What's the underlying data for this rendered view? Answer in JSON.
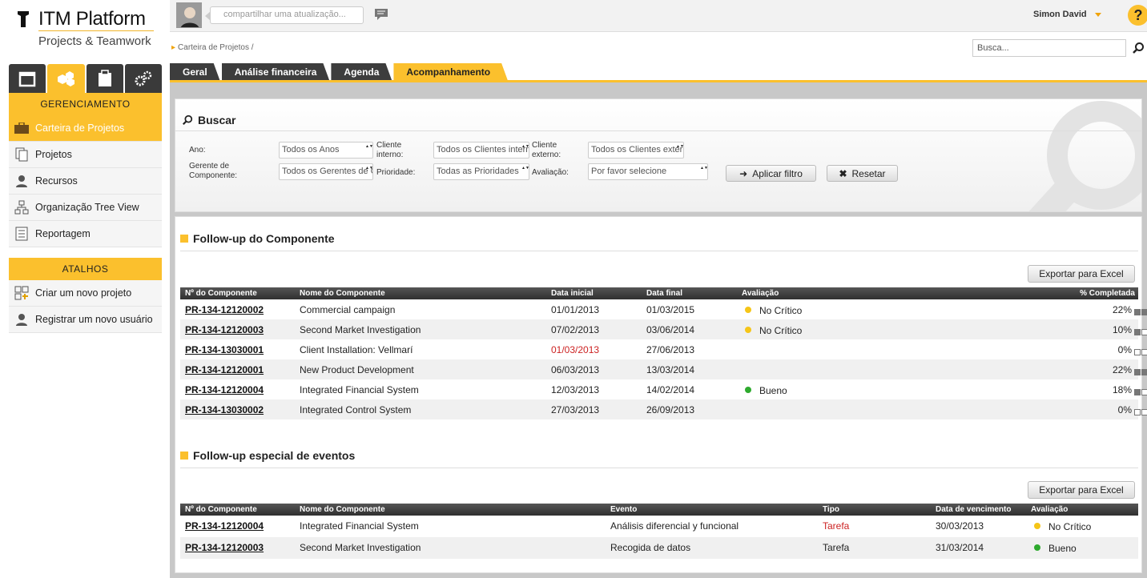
{
  "app": {
    "title": "ITM Platform",
    "subtitle": "Projects & Teamwork"
  },
  "sidebar": {
    "tabs": [
      "calendar-icon",
      "projects-cubes-icon",
      "clipboard-icon",
      "gears-icon"
    ],
    "section1": "GERENCIAMENTO",
    "items": [
      {
        "label": "Carteira de Projetos",
        "icon": "briefcase-icon",
        "active": true
      },
      {
        "label": "Projetos",
        "icon": "documents-icon"
      },
      {
        "label": "Recursos",
        "icon": "person-icon"
      },
      {
        "label": "Organização Tree View",
        "icon": "tree-icon"
      },
      {
        "label": "Reportagem",
        "icon": "report-icon"
      }
    ],
    "section2": "ATALHOS",
    "shortcuts": [
      {
        "label": "Criar um novo projeto",
        "icon": "new-project-icon"
      },
      {
        "label": "Registrar um novo usuário",
        "icon": "person-icon"
      }
    ]
  },
  "topbar": {
    "share_placeholder": "compartilhar uma atualização...",
    "user": "Simon David",
    "help": "?"
  },
  "breadcrumb": "Carteira de Projetos /",
  "search": {
    "placeholder": "Busca..."
  },
  "tabs": [
    "Geral",
    "Análise financeira",
    "Agenda",
    "Acompanhamento"
  ],
  "filter": {
    "title": "Buscar",
    "ano_label": "Ano:",
    "ano_value": "Todos os Anos",
    "cliente_interno_label": "Cliente interno:",
    "cliente_interno_value": "Todos os Clientes internos",
    "cliente_externo_label": "Cliente externo:",
    "cliente_externo_value": "Todos os Clientes externos",
    "gerente_label": "Gerente de Componente:",
    "gerente_value": "Todos os Gerentes de Componente",
    "prioridade_label": "Prioridade:",
    "prioridade_value": "Todas as Prioridades",
    "avaliacao_label": "Avaliação:",
    "avaliacao_value": "Por favor selecione",
    "apply": "Aplicar filtro",
    "reset": "Resetar"
  },
  "followup": {
    "title": "Follow-up do Componente",
    "export": "Exportar para Excel",
    "headers": [
      "Nº do Componente",
      "Nome do Componente",
      "Data inicial",
      "Data final",
      "Avaliação",
      "% Completada"
    ],
    "rows": [
      {
        "code": "PR-134-12120002",
        "name": "Commercial campaign",
        "start": "01/01/2013",
        "end": "01/03/2015",
        "eval": "No Crítico",
        "color": "#f5c518",
        "pct": "22%",
        "filled": 2
      },
      {
        "code": "PR-134-12120003",
        "name": "Second Market Investigation",
        "start": "07/02/2013",
        "end": "03/06/2014",
        "eval": "No Crítico",
        "color": "#f5c518",
        "pct": "10%",
        "filled": 1
      },
      {
        "code": "PR-134-13030001",
        "name": "Client Installation: Vellmarí",
        "start": "01/03/2013",
        "end": "27/06/2013",
        "eval": "",
        "color": "",
        "pct": "0%",
        "filled": 0,
        "start_red": true
      },
      {
        "code": "PR-134-12120001",
        "name": "New Product Development",
        "start": "06/03/2013",
        "end": "13/03/2014",
        "eval": "",
        "color": "",
        "pct": "22%",
        "filled": 2
      },
      {
        "code": "PR-134-12120004",
        "name": "Integrated Financial System",
        "start": "12/03/2013",
        "end": "14/02/2014",
        "eval": "Bueno",
        "color": "#2eaa2e",
        "pct": "18%",
        "filled": 1
      },
      {
        "code": "PR-134-13030002",
        "name": "Integrated Control System",
        "start": "27/03/2013",
        "end": "26/09/2013",
        "eval": "",
        "color": "",
        "pct": "0%",
        "filled": 0
      }
    ]
  },
  "events": {
    "title": "Follow-up especial de eventos",
    "export": "Exportar para Excel",
    "headers": [
      "Nº do Componente",
      "Nome do Componente",
      "Evento",
      "Tipo",
      "Data de vencimento",
      "Avaliação"
    ],
    "rows": [
      {
        "code": "PR-134-12120004",
        "name": "Integrated Financial System",
        "event": "Análisis diferencial y funcional",
        "type": "Tarefa",
        "type_red": true,
        "due": "30/03/2013",
        "eval": "No Crítico",
        "color": "#f5c518"
      },
      {
        "code": "PR-134-12120003",
        "name": "Second Market Investigation",
        "event": "Recogida de datos",
        "type": "Tarefa",
        "type_red": false,
        "due": "31/03/2014",
        "eval": "Bueno",
        "color": "#2eaa2e"
      }
    ]
  }
}
